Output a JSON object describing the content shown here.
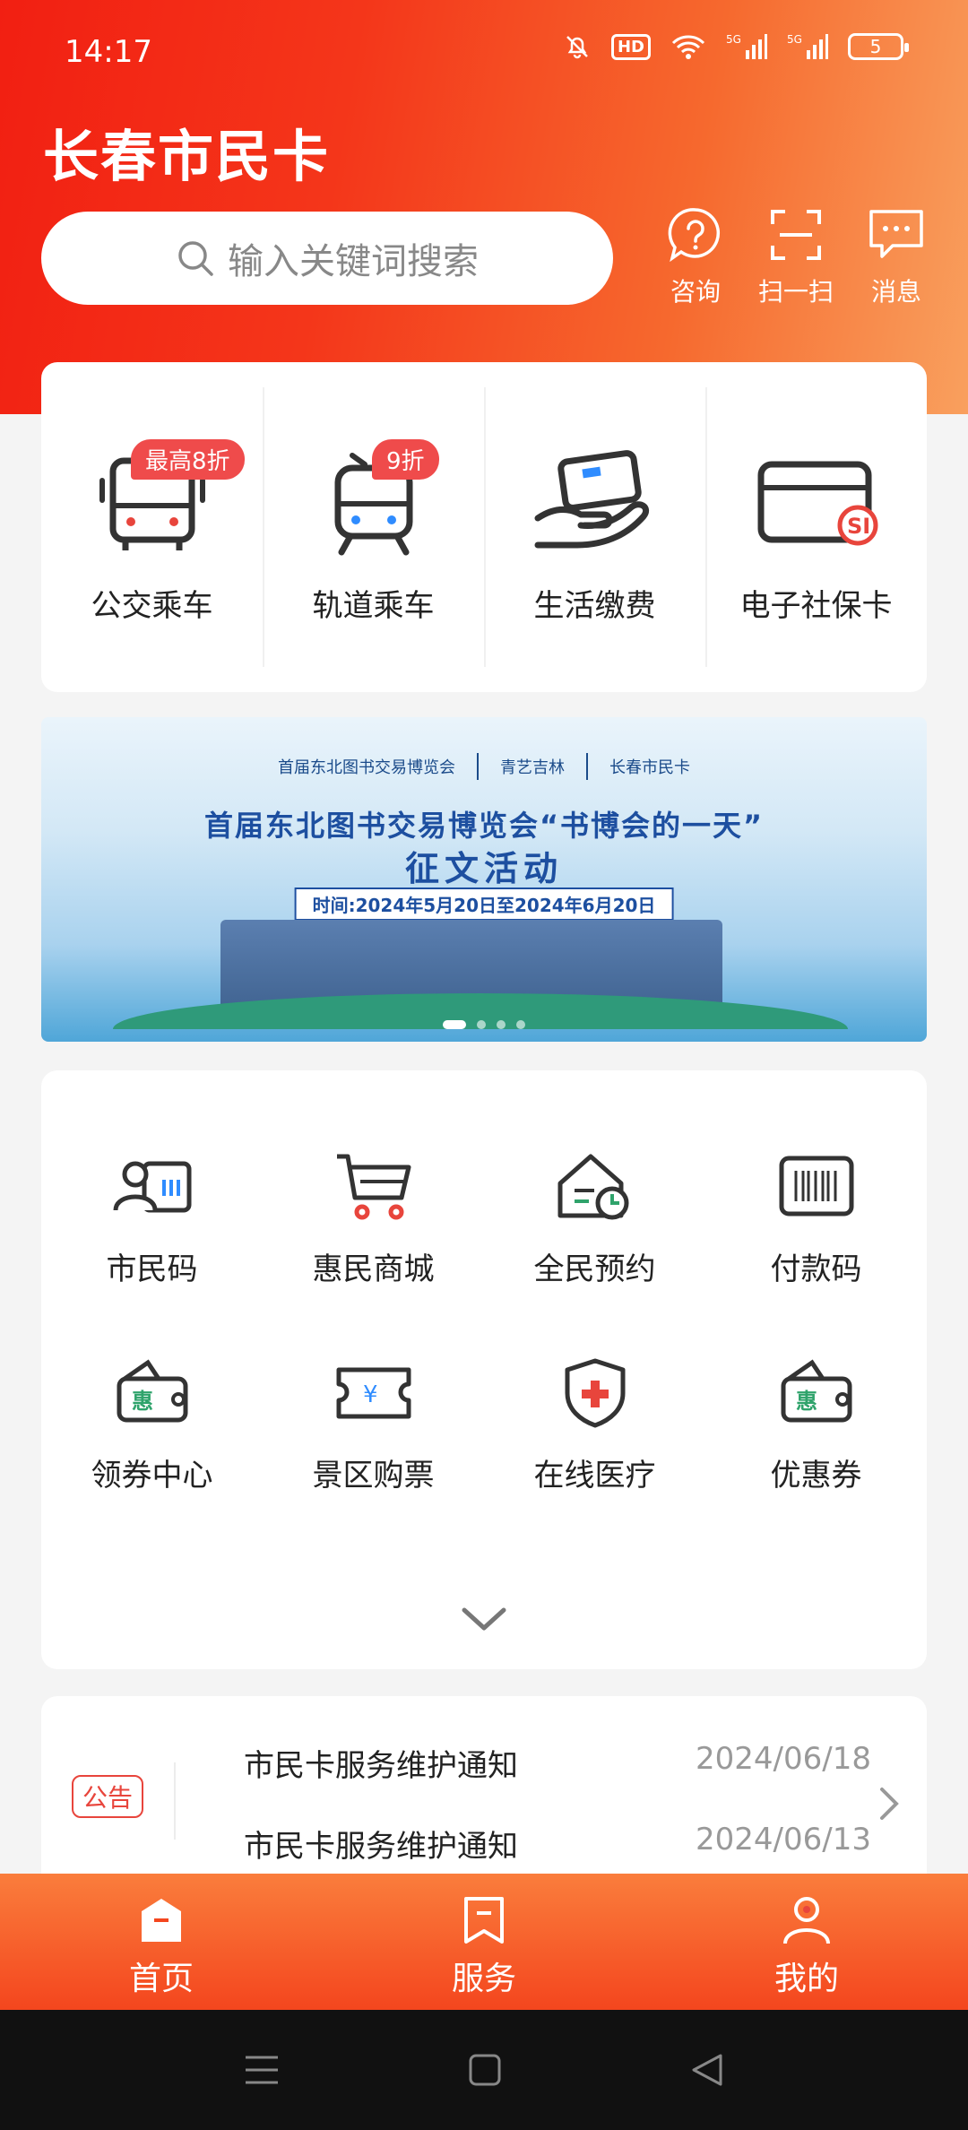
{
  "status_bar": {
    "time": "14:17",
    "battery": "5",
    "hd_label": "HD",
    "network_5g": "5G"
  },
  "app": {
    "title": "长春市民卡"
  },
  "search": {
    "placeholder": "输入关键词搜索"
  },
  "top_actions": [
    {
      "label": "咨询",
      "icon": "help-bubble-icon"
    },
    {
      "label": "扫一扫",
      "icon": "scan-icon"
    },
    {
      "label": "消息",
      "icon": "message-icon"
    }
  ],
  "quick_services": [
    {
      "label": "公交乘车",
      "badge": "最高8折",
      "icon": "bus-icon"
    },
    {
      "label": "轨道乘车",
      "badge": "9折",
      "icon": "metro-icon"
    },
    {
      "label": "生活缴费",
      "badge": "",
      "icon": "payment-hand-icon"
    },
    {
      "label": "电子社保卡",
      "badge": "",
      "icon": "social-security-card-icon"
    }
  ],
  "banner": {
    "logo_1": "首届东北图书交易博览会",
    "logo_2": "青艺吉林",
    "logo_3": "长春市民卡",
    "title": "首届东北图书交易博览会“书博会的一天”",
    "subtitle": "征文活动",
    "date": "时间:2024年5月20日至2024年6月20日"
  },
  "services": [
    {
      "label": "市民码",
      "icon": "citizen-code-icon"
    },
    {
      "label": "惠民商城",
      "icon": "shopping-cart-icon"
    },
    {
      "label": "全民预约",
      "icon": "appointment-icon"
    },
    {
      "label": "付款码",
      "icon": "barcode-icon"
    },
    {
      "label": "领券中心",
      "icon": "coupon-wallet-icon"
    },
    {
      "label": "景区购票",
      "icon": "ticket-icon"
    },
    {
      "label": "在线医疗",
      "icon": "medical-shield-icon"
    },
    {
      "label": "优惠券",
      "icon": "discount-wallet-icon"
    }
  ],
  "notices": {
    "tag": "公告",
    "items": [
      {
        "title": "市民卡服务维护通知",
        "date": "2024/06/18"
      },
      {
        "title": "市民卡服务维护通知",
        "date": "2024/06/13"
      }
    ]
  },
  "tabs": [
    {
      "label": "首页",
      "icon": "home-icon",
      "active": true
    },
    {
      "label": "服务",
      "icon": "service-bookmark-icon",
      "active": false
    },
    {
      "label": "我的",
      "icon": "profile-icon",
      "active": false
    }
  ],
  "colors": {
    "accent": "#f4361a",
    "badge": "#ef4b4b",
    "notice": "#e8453c"
  }
}
